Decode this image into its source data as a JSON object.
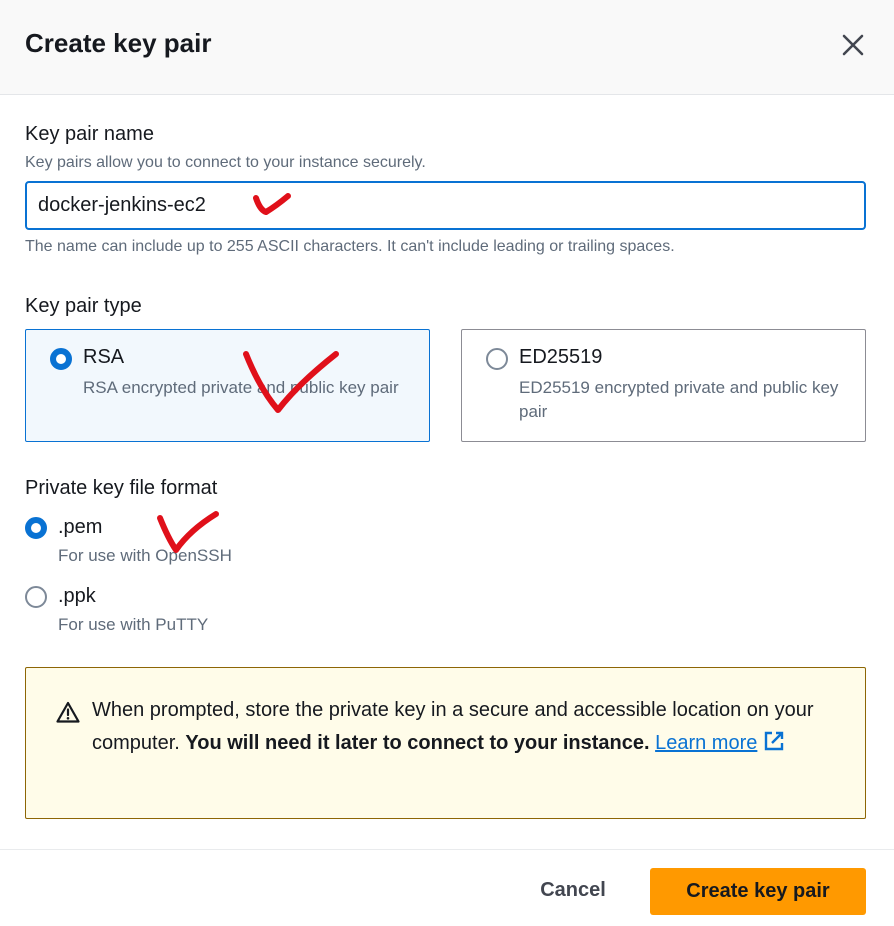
{
  "dialog": {
    "title": "Create key pair",
    "close_icon": "close-icon"
  },
  "key_pair_name": {
    "label": "Key pair name",
    "description": "Key pairs allow you to connect to your instance securely.",
    "value": "docker-jenkins-ec2",
    "constraint": "The name can include up to 255 ASCII characters. It can't include leading or trailing spaces."
  },
  "key_pair_type": {
    "label": "Key pair type",
    "selected": "RSA",
    "options": [
      {
        "title": "RSA",
        "description": "RSA encrypted private and public key pair"
      },
      {
        "title": "ED25519",
        "description": "ED25519 encrypted private and public key pair"
      }
    ]
  },
  "file_format": {
    "label": "Private key file format",
    "selected": ".pem",
    "options": [
      {
        "title": ".pem",
        "description": "For use with OpenSSH"
      },
      {
        "title": ".ppk",
        "description": "For use with PuTTY"
      }
    ]
  },
  "alert": {
    "icon": "warning-icon",
    "text": "When prompted, store the private key in a secure and accessible location on your computer.",
    "bold_text": "You will need it later to connect to your instance.",
    "link_text": "Learn more",
    "link_icon": "external-link-icon"
  },
  "footer": {
    "cancel_label": "Cancel",
    "create_label": "Create key pair"
  },
  "colors": {
    "accent": "#0972d3",
    "primary_button": "#ff9900",
    "annotation": "#e0101a",
    "warning_border": "#8d6605"
  }
}
